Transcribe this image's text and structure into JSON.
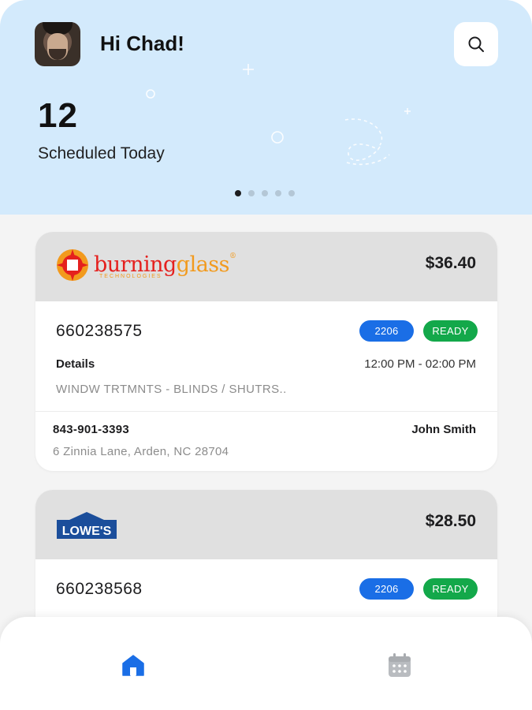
{
  "header": {
    "greeting": "Hi Chad!",
    "scheduled_count": "12",
    "scheduled_label": "Scheduled Today",
    "carousel_pages": 5,
    "carousel_active_index": 0,
    "background_color": "#d3eafc",
    "search_icon": "search-icon"
  },
  "cards": [
    {
      "brand": "burningglass",
      "brand_word_1": "burning",
      "brand_word_2": "glass",
      "brand_sub": "TECHNOLOGIES",
      "brand_mark": "®",
      "price": "$36.40",
      "order_number": "660238575",
      "badge_code": "2206",
      "status": "READY",
      "details_label": "Details",
      "time_window": "12:00 PM - 02:00 PM",
      "description": "WINDW TRTMNTS - BLINDS / SHUTRS..",
      "phone": "843-901-3393",
      "contact_name": "John Smith",
      "address": "6 Zinnia Lane, Arden, NC 28704"
    },
    {
      "brand": "LOWE'S",
      "brand_label": "LOWE'S",
      "price": "$28.50",
      "order_number": "660238568",
      "badge_code": "2206",
      "status": "READY"
    }
  ],
  "nav": {
    "items": [
      {
        "icon": "home-icon",
        "active": true
      },
      {
        "icon": "calendar-icon",
        "active": false
      }
    ],
    "active_color": "#1a6ee6",
    "inactive_color": "#b9bcc0"
  },
  "colors": {
    "badge_blue": "#1a6ee6",
    "badge_green": "#13a84a",
    "card_header": "#e0e0e0"
  }
}
